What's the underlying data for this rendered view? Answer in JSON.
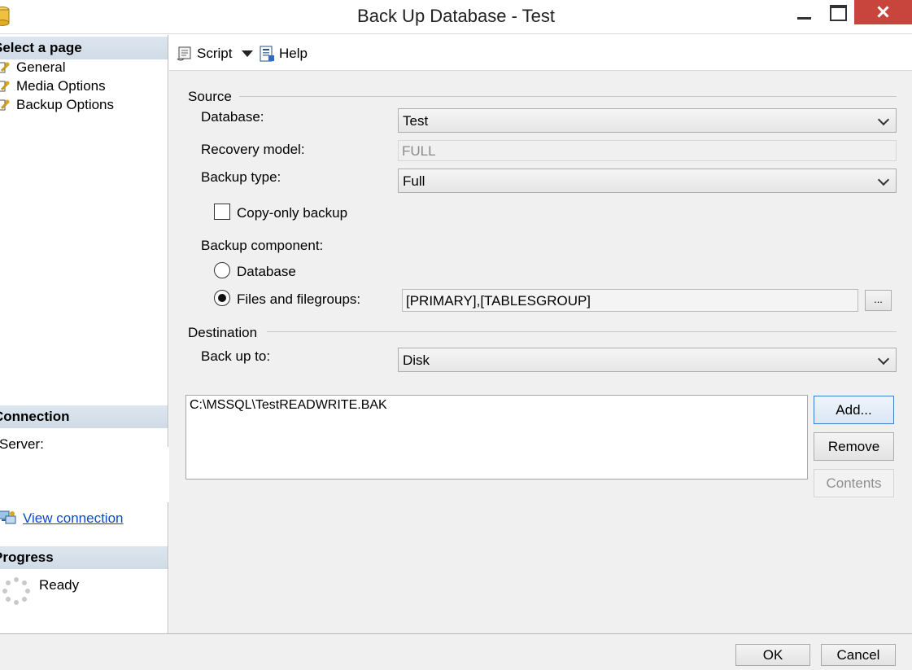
{
  "window": {
    "title": "Back Up Database - Test"
  },
  "sidebar": {
    "select_page_header": "Select a page",
    "pages": [
      {
        "label": "General"
      },
      {
        "label": "Media Options"
      },
      {
        "label": "Backup Options"
      }
    ],
    "connection_header": "Connection",
    "server_label": "Server:",
    "view_connection_link": "View connection",
    "progress_header": "Progress",
    "progress_status": "Ready"
  },
  "toolbar": {
    "script_label": "Script",
    "help_label": "Help"
  },
  "source": {
    "group_title": "Source",
    "database_label": "Database:",
    "database_value": "Test",
    "recovery_model_label": "Recovery model:",
    "recovery_model_value": "FULL",
    "backup_type_label": "Backup type:",
    "backup_type_value": "Full",
    "copy_only_label": "Copy-only backup",
    "copy_only_checked": false,
    "backup_component_label": "Backup component:",
    "component_database_label": "Database",
    "component_files_label": "Files and filegroups:",
    "selected_component": "Files and filegroups",
    "filegroups_value": "[PRIMARY],[TABLESGROUP]",
    "browse_button_label": "..."
  },
  "destination": {
    "group_title": "Destination",
    "back_up_to_label": "Back up to:",
    "back_up_to_value": "Disk",
    "paths": [
      "C:\\MSSQL\\TestREADWRITE.BAK"
    ],
    "add_button": "Add...",
    "remove_button": "Remove",
    "contents_button": "Contents"
  },
  "footer": {
    "ok_button": "OK",
    "cancel_button": "Cancel"
  },
  "colors": {
    "close_button": "#c7453d",
    "link": "#0a4cc8",
    "section_header": "#d6e0ea",
    "panel_background": "#f0f0f0"
  }
}
